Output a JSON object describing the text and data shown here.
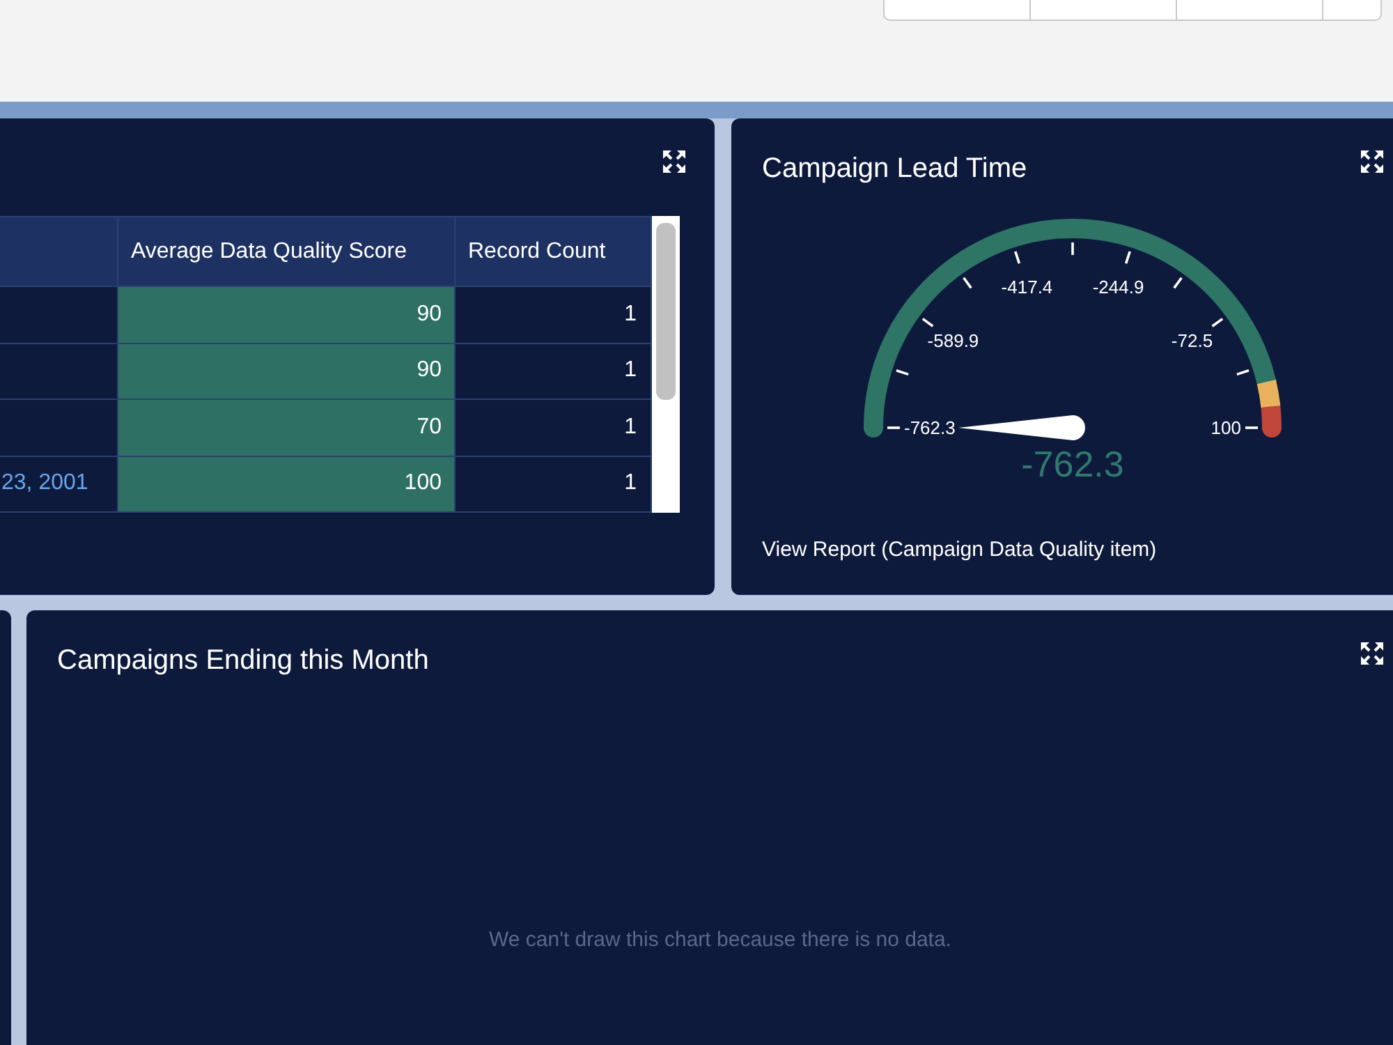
{
  "toolbar": {
    "buttons": [
      {
        "kind": "action"
      },
      {
        "kind": "action"
      },
      {
        "kind": "action"
      },
      {
        "kind": "menu"
      }
    ]
  },
  "table_panel": {
    "table": {
      "columns": [
        "Average Data Quality Score",
        "Record Count"
      ],
      "rows": [
        {
          "cells": [
            "90",
            "1"
          ]
        },
        {
          "cells": [
            "90",
            "1"
          ]
        },
        {
          "cells": [
            "70",
            "1"
          ]
        },
        {
          "column_1": "23, 2001",
          "cells": [
            "100",
            "1"
          ]
        }
      ]
    }
  },
  "gauge_panel": {
    "title": "Campaign Lead Time",
    "gauge": {
      "ticks": [
        "-762.3",
        "-589.9",
        "-417.4",
        "-244.9",
        "-72.5",
        "100"
      ],
      "bands": [
        {
          "color": "#2e7566"
        },
        {
          "color": "#ebb25e"
        },
        {
          "color": "#c1463a"
        }
      ],
      "reading": "-762.3"
    },
    "link": "View Report (Campaign Data Quality item)"
  },
  "ending_panel": {
    "title": "Campaigns Ending this Month",
    "message": "We can't draw this chart because there is no data."
  }
}
